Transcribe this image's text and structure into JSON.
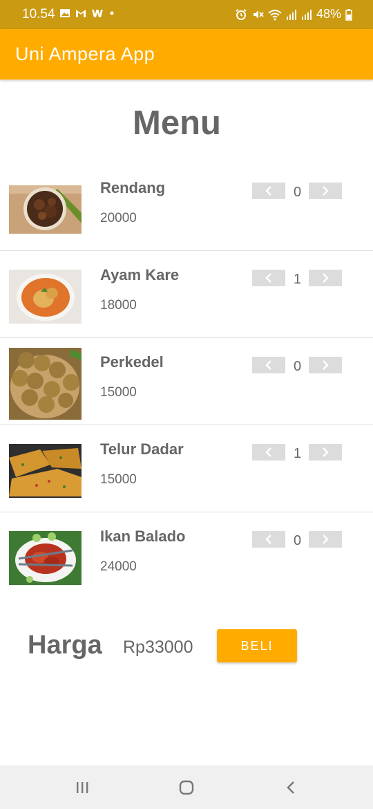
{
  "status_bar": {
    "time": "10.54",
    "battery": "48%",
    "left_icons": [
      "image-icon",
      "gmail-icon",
      "w-icon",
      "dot-icon"
    ],
    "right_icons": [
      "alarm-icon",
      "mute-icon",
      "wifi-icon",
      "signal-icon",
      "signal-icon",
      "battery-icon"
    ]
  },
  "app_bar": {
    "title": "Uni Ampera App",
    "color": "#ffab00"
  },
  "page_title": "Menu",
  "menu": [
    {
      "name": "Rendang",
      "price": "20000",
      "qty": "0",
      "image": "rendang-image"
    },
    {
      "name": "Ayam Kare",
      "price": "18000",
      "qty": "1",
      "image": "ayam-kare-image"
    },
    {
      "name": "Perkedel",
      "price": "15000",
      "qty": "0",
      "image": "perkedel-image"
    },
    {
      "name": "Telur Dadar",
      "price": "15000",
      "qty": "1",
      "image": "telur-dadar-image"
    },
    {
      "name": "Ikan Balado",
      "price": "24000",
      "qty": "0",
      "image": "ikan-balado-image"
    }
  ],
  "footer": {
    "harga_label": "Harga",
    "harga_value": "Rp33000",
    "beli_label": "BELI"
  },
  "nav_bar": {
    "icons": [
      "recents-icon",
      "home-icon",
      "back-icon"
    ]
  },
  "colors": {
    "accent": "#ffab00",
    "status_bar": "#c99a12",
    "stepper": "#dcdcdc",
    "text": "#666666"
  }
}
